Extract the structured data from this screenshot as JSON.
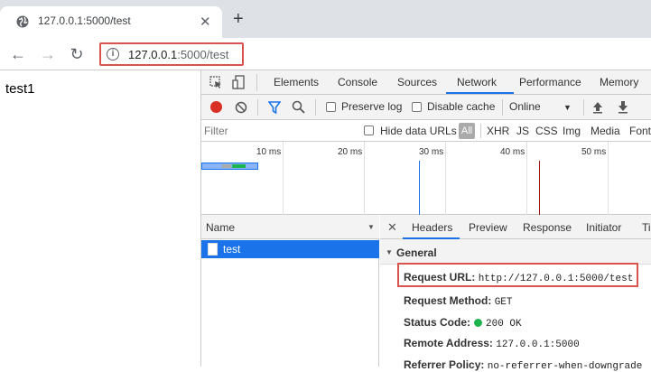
{
  "browser": {
    "tab_title": "127.0.0.1:5000/test",
    "url_host": "127.0.0.1",
    "url_path": ":5000/test"
  },
  "page": {
    "body_text": "test1"
  },
  "devtools": {
    "tabs": [
      "Elements",
      "Console",
      "Sources",
      "Network",
      "Performance",
      "Memory"
    ],
    "active_tab": "Network",
    "controls": {
      "preserve_log": "Preserve log",
      "disable_cache": "Disable cache",
      "throttle": "Online"
    },
    "filter": {
      "placeholder": "Filter",
      "hide_data_urls": "Hide data URLs",
      "types": [
        "All",
        "XHR",
        "JS",
        "CSS",
        "Img",
        "Media",
        "Font"
      ]
    },
    "timeline_ticks": [
      "10 ms",
      "20 ms",
      "30 ms",
      "40 ms",
      "50 ms"
    ],
    "requests": {
      "column_name": "Name",
      "rows": [
        {
          "name": "test"
        }
      ]
    },
    "detail": {
      "tabs": [
        "Headers",
        "Preview",
        "Response",
        "Initiator",
        "Ti"
      ],
      "active_tab": "Headers",
      "section": "General",
      "rows": [
        {
          "key": "Request URL:",
          "value": "http://127.0.0.1:5000/test"
        },
        {
          "key": "Request Method:",
          "value": "GET"
        },
        {
          "key": "Status Code:",
          "value": "200 OK"
        },
        {
          "key": "Remote Address:",
          "value": "127.0.0.1:5000"
        },
        {
          "key": "Referrer Policy:",
          "value": "no-referrer-when-downgrade"
        }
      ]
    }
  },
  "colors": {
    "accent": "#1a73e8",
    "highlight_box": "#d9534f",
    "status_ok": "#1db34e"
  }
}
